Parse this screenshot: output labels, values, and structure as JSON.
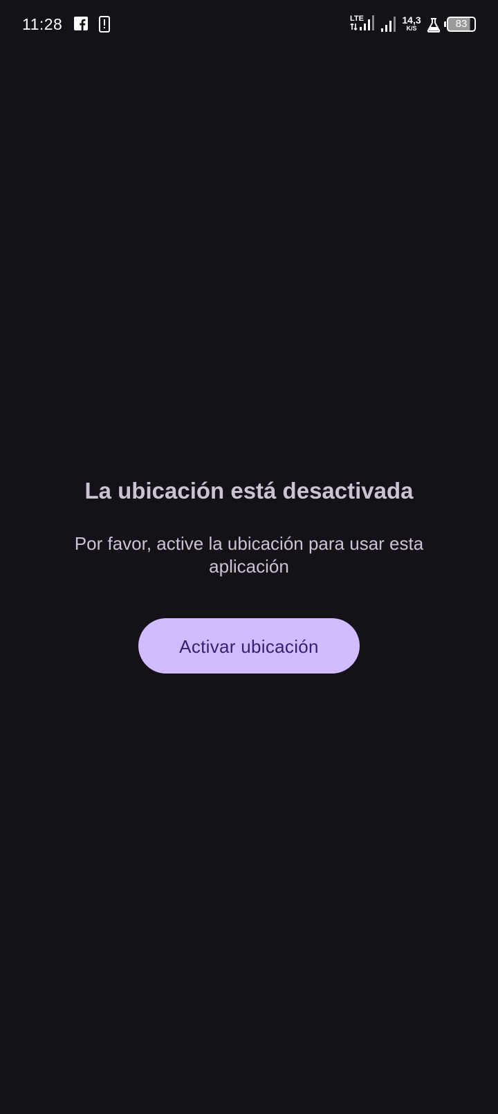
{
  "status_bar": {
    "time": "11:28",
    "network_type": "LTE",
    "net_speed_value": "14,3",
    "net_speed_unit": "K/S",
    "battery_level": "83",
    "battery_fraction": 0.83,
    "icons": [
      "facebook-icon",
      "alert-icon",
      "lte-signal-icon",
      "signal-icon",
      "flask-icon",
      "battery-icon"
    ]
  },
  "main": {
    "title": "La ubicación está desactivada",
    "message": "Por favor, active la ubicación para usar esta aplicación",
    "button_label": "Activar ubicación"
  },
  "colors": {
    "background": "#141218",
    "text_muted": "#cac4d0",
    "button_bg": "#d0bcff",
    "button_text": "#381e72"
  }
}
